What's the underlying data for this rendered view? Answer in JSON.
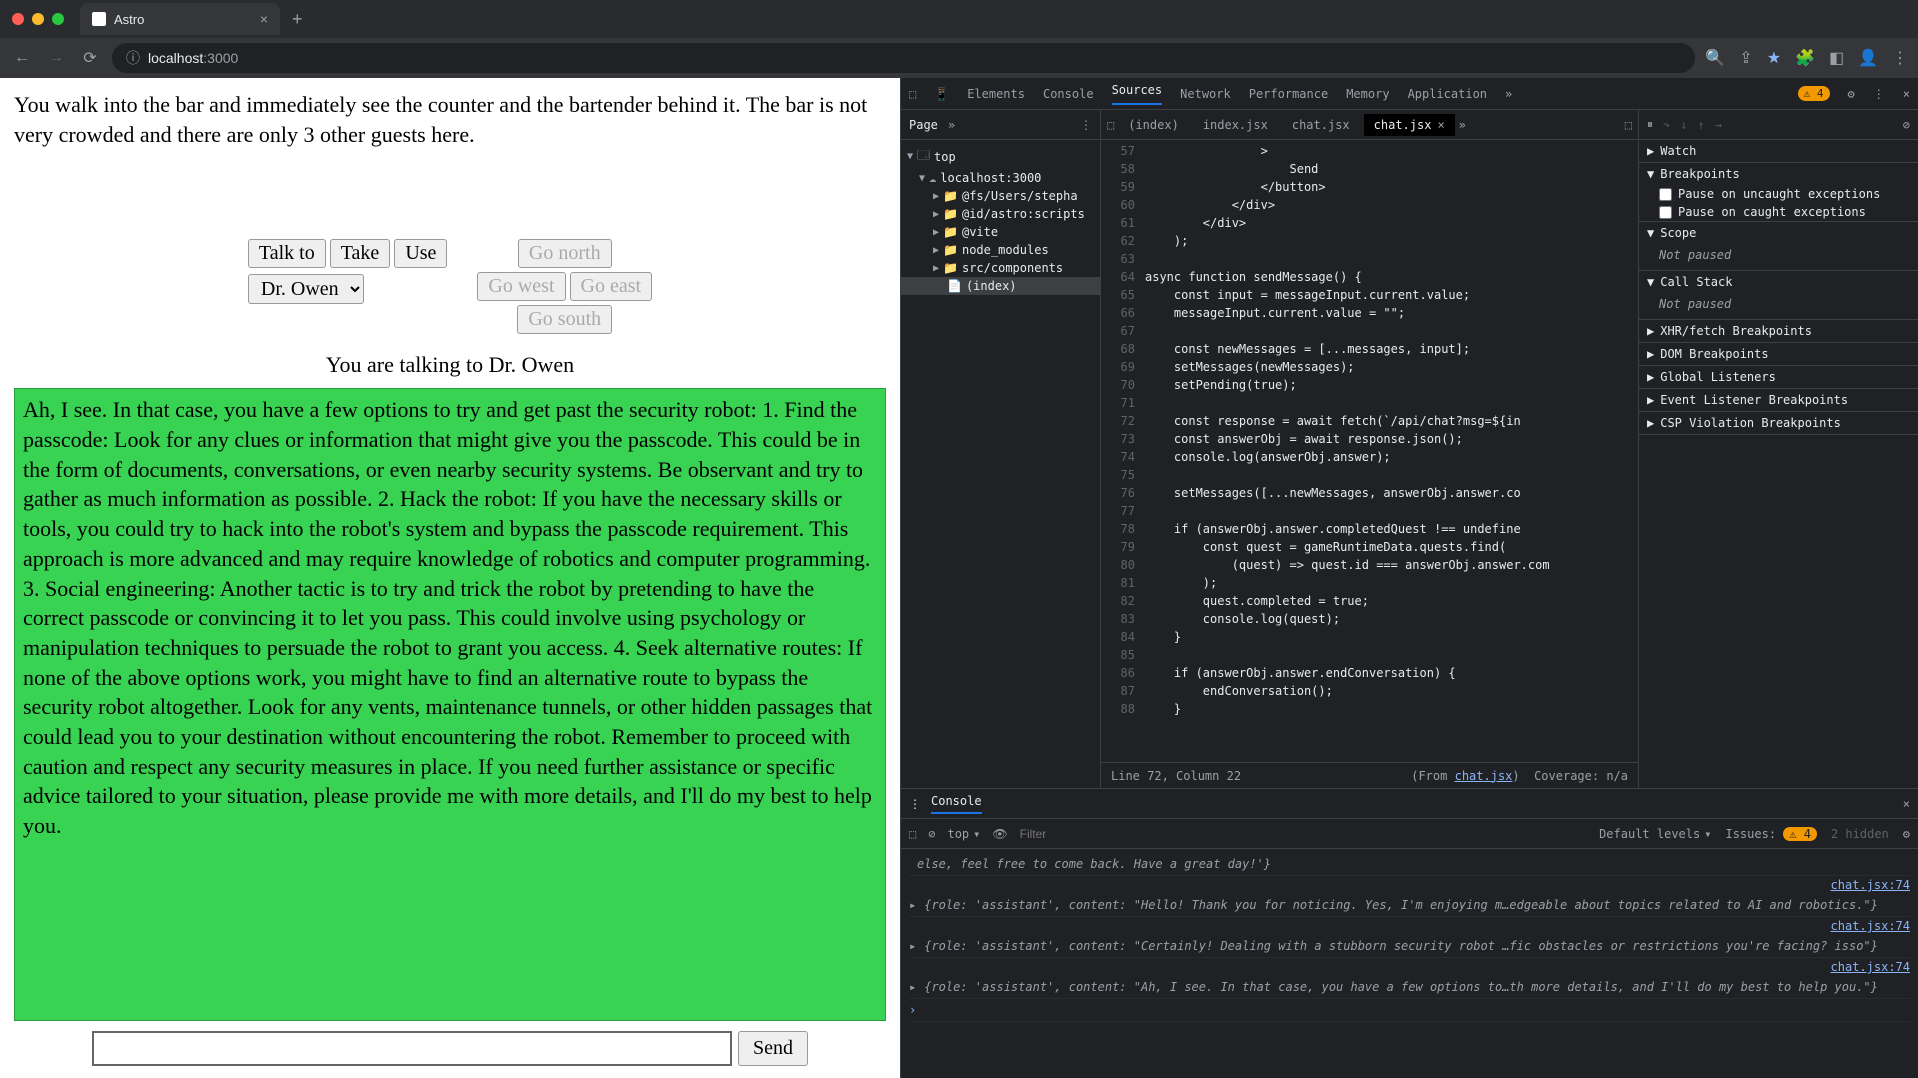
{
  "browser": {
    "tab_title": "Astro",
    "url_host": "localhost",
    "url_port": ":3000"
  },
  "game": {
    "intro": "You walk into the bar and immediately see the counter and the bartender behind it. The bar is not very crowded and there are only 3 other guests here.",
    "actions": {
      "talk": "Talk to",
      "take": "Take",
      "use": "Use"
    },
    "dropdown": "Dr. Owen",
    "dirs": {
      "north": "Go north",
      "west": "Go west",
      "east": "Go east",
      "south": "Go south"
    },
    "talking": "You are talking to Dr. Owen",
    "message": "Ah, I see. In that case, you have a few options to try and get past the security robot: 1. Find the passcode: Look for any clues or information that might give you the passcode. This could be in the form of documents, conversations, or even nearby security systems. Be observant and try to gather as much information as possible. 2. Hack the robot: If you have the necessary skills or tools, you could try to hack into the robot's system and bypass the passcode requirement. This approach is more advanced and may require knowledge of robotics and computer programming. 3. Social engineering: Another tactic is to try and trick the robot by pretending to have the correct passcode or convincing it to let you pass. This could involve using psychology or manipulation techniques to persuade the robot to grant you access. 4. Seek alternative routes: If none of the above options work, you might have to find an alternative route to bypass the security robot altogether. Look for any vents, maintenance tunnels, or other hidden passages that could lead you to your destination without encountering the robot. Remember to proceed with caution and respect any security measures in place. If you need further assistance or specific advice tailored to your situation, please provide me with more details, and I'll do my best to help you.",
    "send": "Send"
  },
  "devtools": {
    "tabs": [
      "Elements",
      "Console",
      "Sources",
      "Network",
      "Performance",
      "Memory",
      "Application"
    ],
    "active_tab": "Sources",
    "issue_badge": "4",
    "page_tab": "Page",
    "tree": {
      "top": "top",
      "host": "localhost:3000",
      "folders": [
        "@fs/Users/stepha",
        "@id/astro:scripts",
        "@vite",
        "node_modules",
        "src/components"
      ],
      "file": "(index)"
    },
    "file_tabs": [
      "(index)",
      "index.jsx",
      "chat.jsx",
      "chat.jsx"
    ],
    "active_file": 3,
    "code_lines": [
      {
        "n": 57,
        "t": "                >"
      },
      {
        "n": 58,
        "t": "                    Send"
      },
      {
        "n": 59,
        "t": "                </button>"
      },
      {
        "n": 60,
        "t": "            </div>"
      },
      {
        "n": 61,
        "t": "        </div>"
      },
      {
        "n": 62,
        "t": "    );"
      },
      {
        "n": 63,
        "t": ""
      },
      {
        "n": 64,
        "t": "async function sendMessage() {"
      },
      {
        "n": 65,
        "t": "    const input = messageInput.current.value;"
      },
      {
        "n": 66,
        "t": "    messageInput.current.value = \"\";"
      },
      {
        "n": 67,
        "t": ""
      },
      {
        "n": 68,
        "t": "    const newMessages = [...messages, input];"
      },
      {
        "n": 69,
        "t": "    setMessages(newMessages);"
      },
      {
        "n": 70,
        "t": "    setPending(true);"
      },
      {
        "n": 71,
        "t": ""
      },
      {
        "n": 72,
        "t": "    const response = await fetch(`/api/chat?msg=${in"
      },
      {
        "n": 73,
        "t": "    const answerObj = await response.json();"
      },
      {
        "n": 74,
        "t": "    console.log(answerObj.answer);"
      },
      {
        "n": 75,
        "t": ""
      },
      {
        "n": 76,
        "t": "    setMessages([...newMessages, answerObj.answer.co"
      },
      {
        "n": 77,
        "t": ""
      },
      {
        "n": 78,
        "t": "    if (answerObj.answer.completedQuest !== undefine"
      },
      {
        "n": 79,
        "t": "        const quest = gameRuntimeData.quests.find("
      },
      {
        "n": 80,
        "t": "            (quest) => quest.id === answerObj.answer.com"
      },
      {
        "n": 81,
        "t": "        );"
      },
      {
        "n": 82,
        "t": "        quest.completed = true;"
      },
      {
        "n": 83,
        "t": "        console.log(quest);"
      },
      {
        "n": 84,
        "t": "    }"
      },
      {
        "n": 85,
        "t": ""
      },
      {
        "n": 86,
        "t": "    if (answerObj.answer.endConversation) {"
      },
      {
        "n": 87,
        "t": "        endConversation();"
      },
      {
        "n": 88,
        "t": "    }"
      }
    ],
    "status": {
      "pos": "Line 72, Column 22",
      "from": "(From ",
      "from_link": "chat.jsx",
      "from_end": ")",
      "cov": "Coverage: n/a"
    },
    "watch": "Watch",
    "breakpoints": "Breakpoints",
    "bp_uncaught": "Pause on uncaught exceptions",
    "bp_caught": "Pause on caught exceptions",
    "scope": "Scope",
    "not_paused": "Not paused",
    "callstack": "Call Stack",
    "xhr": "XHR/fetch Breakpoints",
    "dom": "DOM Breakpoints",
    "glob": "Global Listeners",
    "evt": "Event Listener Breakpoints",
    "csp": "CSP Violation Breakpoints"
  },
  "console": {
    "title": "Console",
    "context": "top",
    "filter_placeholder": "Filter",
    "levels": "Default levels",
    "issues_label": "Issues:",
    "issues_count": "4",
    "hidden": "2 hidden",
    "logs": [
      {
        "pre": "else, feel free to come back. Have a great day!'}",
        "src": ""
      },
      {
        "obj": "{role: 'assistant', content: \"Hello! Thank you for noticing. Yes, I'm enjoying m…edgeable about topics related to AI and robotics.\"}",
        "src": "chat.jsx:74"
      },
      {
        "obj": "{role: 'assistant', content: \"Certainly! Dealing with a stubborn security robot …fic obstacles or restrictions you're facing? isso\"}",
        "src": "chat.jsx:74"
      },
      {
        "obj": "{role: 'assistant', content: \"Ah, I see. In that case, you have a few options to…th more details, and I'll do my best to help you.\"}",
        "src": "chat.jsx:74"
      }
    ]
  }
}
